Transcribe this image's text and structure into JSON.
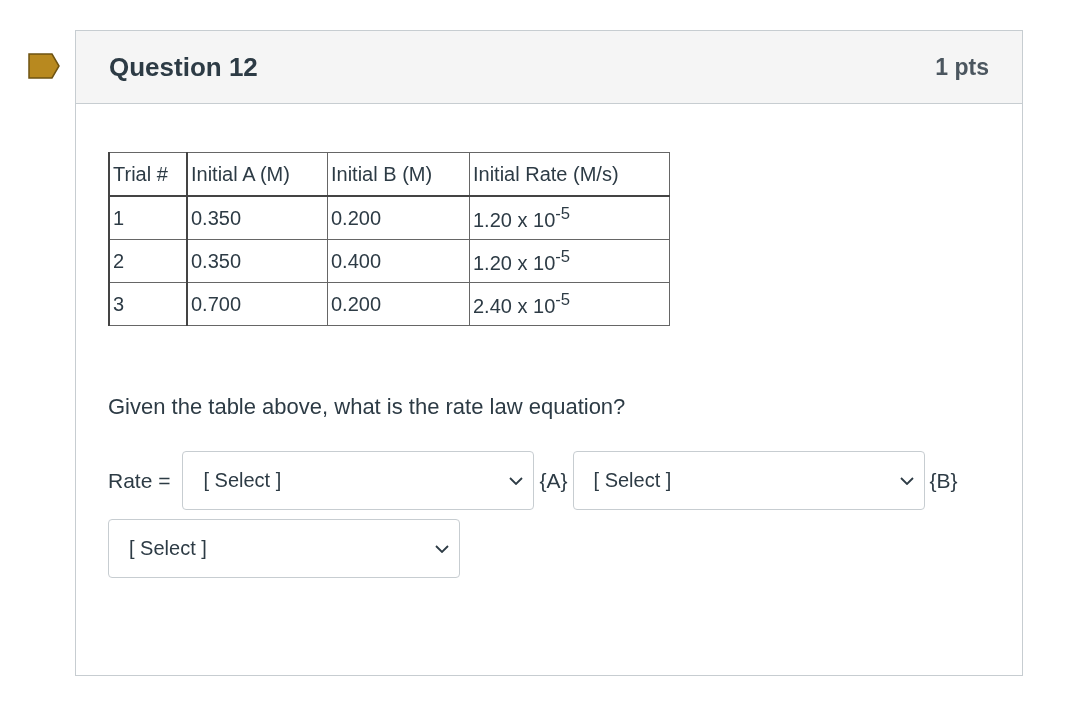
{
  "question": {
    "title": "Question 12",
    "points": "1 pts"
  },
  "table": {
    "columns": [
      "Trial #",
      "Initial A (M)",
      "Initial B (M)",
      "Initial Rate (M/s)"
    ],
    "rows": [
      [
        "1",
        "0.350",
        "0.200",
        "1.20 x 10$^{-5}$"
      ],
      [
        "2",
        "0.350",
        "0.400",
        "1.20 x 10$^{-5}$"
      ],
      [
        "3",
        "0.700",
        "0.200",
        "2.40 x 10$^{-5}$"
      ]
    ]
  },
  "prompt": "Given the table above, what is the rate law equation?",
  "answer": [
    {
      "kind": "text",
      "text": "Rate ="
    },
    {
      "kind": "select",
      "value": "[ Select ]"
    },
    {
      "kind": "text",
      "text": "{A}"
    },
    {
      "kind": "select",
      "value": "[ Select ]"
    },
    {
      "kind": "text",
      "text": "{B}"
    },
    {
      "kind": "select",
      "value": "[ Select ]"
    }
  ]
}
